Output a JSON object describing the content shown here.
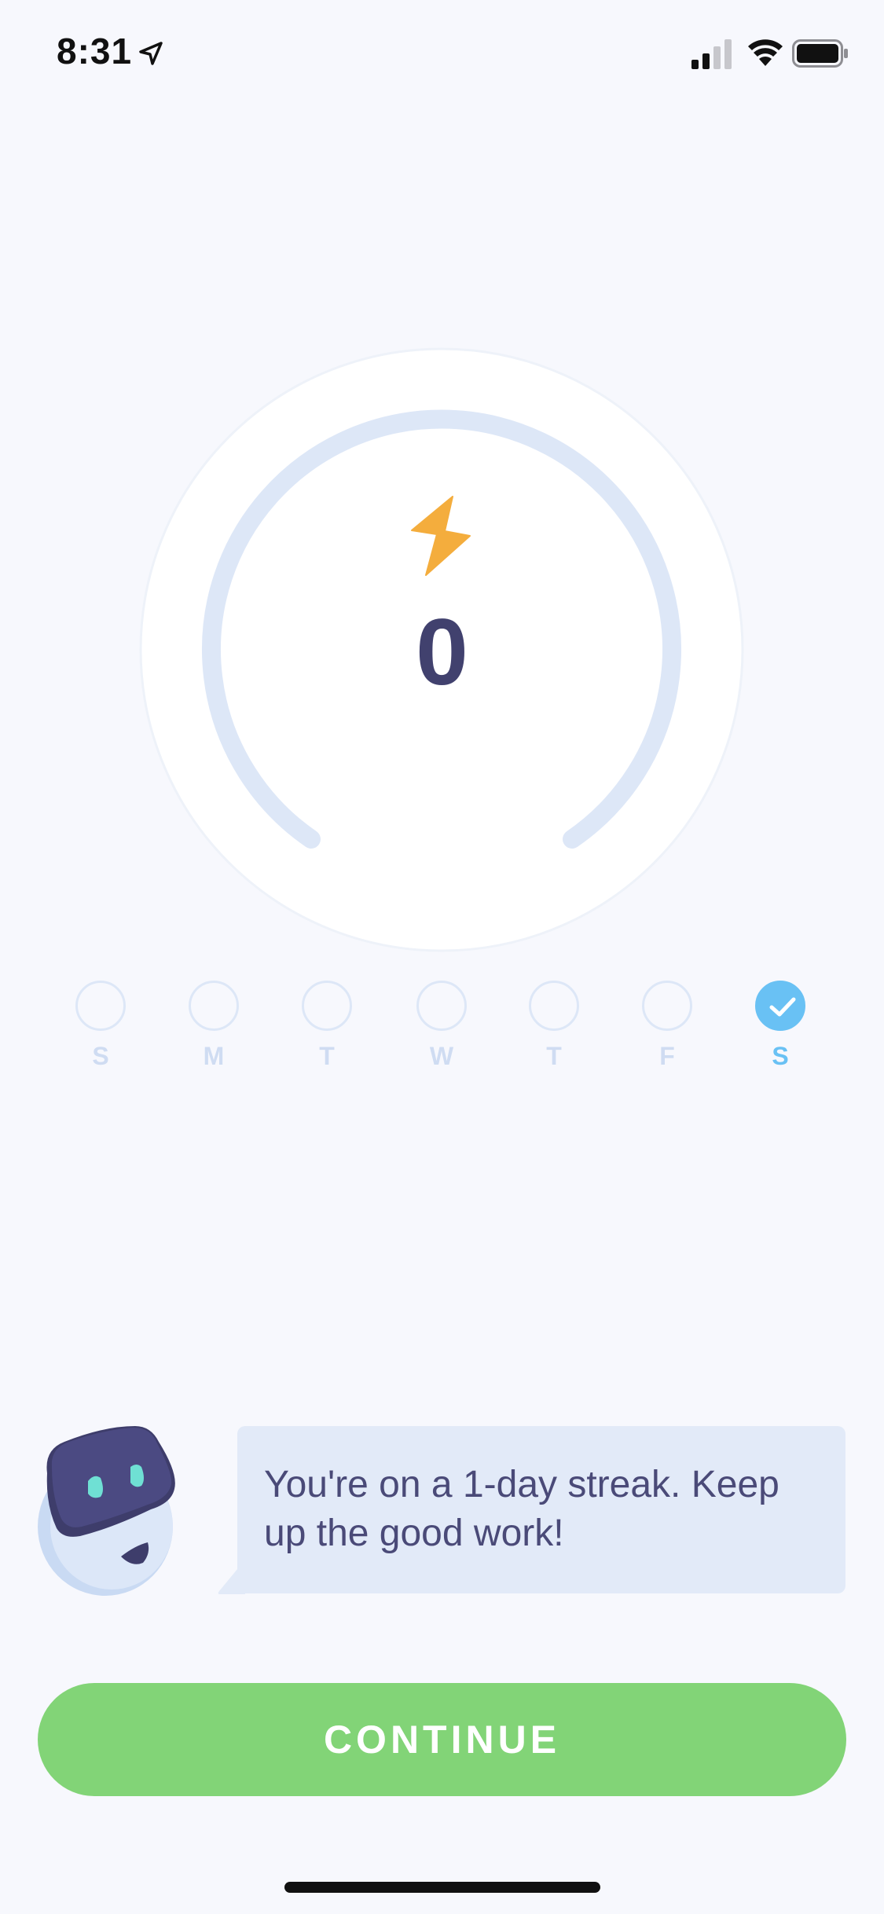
{
  "status_bar": {
    "time": "8:31"
  },
  "streak": {
    "count": "0",
    "icon": "lightning-bolt-icon",
    "accent_color": "#f4ad3d"
  },
  "week": {
    "days": [
      {
        "label": "S",
        "completed": false
      },
      {
        "label": "M",
        "completed": false
      },
      {
        "label": "T",
        "completed": false
      },
      {
        "label": "W",
        "completed": false
      },
      {
        "label": "T",
        "completed": false
      },
      {
        "label": "F",
        "completed": false
      },
      {
        "label": "S",
        "completed": true
      }
    ],
    "completed_color": "#69c1f4"
  },
  "message": {
    "text": "You're on a 1-day streak. Keep up the good work!"
  },
  "actions": {
    "continue_label": "CONTINUE",
    "continue_color": "#82d477"
  }
}
